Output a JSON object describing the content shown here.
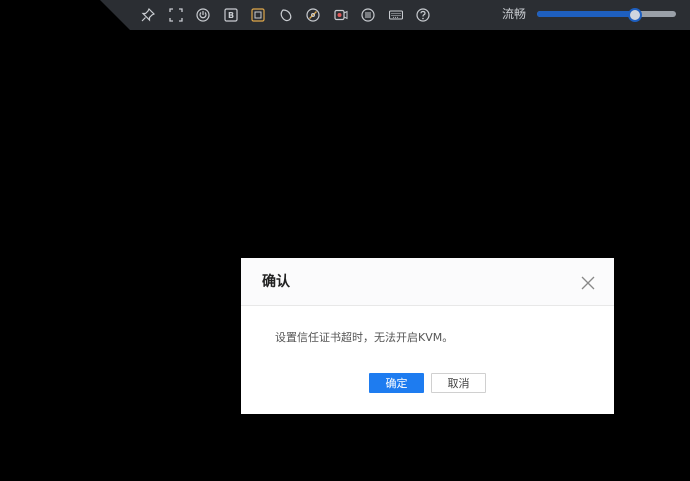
{
  "toolbar": {
    "icons": [
      "pin-icon",
      "fullscreen-icon",
      "power-icon",
      "bios-icon",
      "image-icon",
      "mouse-icon",
      "disc-icon",
      "record-icon",
      "menu-icon",
      "keyboard-icon",
      "help-icon"
    ],
    "mode_label": "流畅",
    "slider_level": 0.7,
    "accent_color": "#1e5fbf"
  },
  "dialog": {
    "title": "确认",
    "message": "设置信任证书超时，无法开启KVM。",
    "confirm_label": "确定",
    "cancel_label": "取消",
    "primary_color": "#1e7cf0"
  }
}
